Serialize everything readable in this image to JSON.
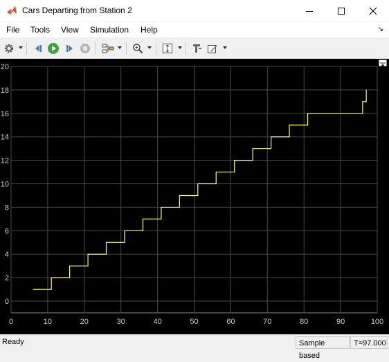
{
  "window": {
    "title": "Cars Departing from Station 2"
  },
  "menu": {
    "items": [
      "File",
      "Tools",
      "View",
      "Simulation",
      "Help"
    ]
  },
  "toolbar": {
    "icons": [
      "settings-icon",
      "step-back-icon",
      "run-icon",
      "step-forward-icon",
      "stop-icon",
      "highlight-icon",
      "zoom-icon",
      "autoscale-icon",
      "cursor-measure-icon",
      "style-icon"
    ]
  },
  "status": {
    "ready": "Ready",
    "mode": "Sample based",
    "time": "T=97.000"
  },
  "colors": {
    "plot_bg": "#000000",
    "grid": "#4a4a4a",
    "axis_text": "#cfcfcf",
    "line": "#ffff66"
  },
  "chart_data": {
    "type": "line",
    "title": "",
    "xlabel": "",
    "ylabel": "",
    "xlim": [
      0,
      100
    ],
    "ylim": [
      -1,
      20
    ],
    "xticks": [
      0,
      10,
      20,
      30,
      40,
      50,
      60,
      70,
      80,
      90,
      100
    ],
    "yticks": [
      0,
      2,
      4,
      6,
      8,
      10,
      12,
      14,
      16,
      18,
      20
    ],
    "grid": true,
    "series": [
      {
        "step": true,
        "x": [
          6,
          11,
          16,
          21,
          26,
          31,
          36,
          41,
          46,
          51,
          56,
          61,
          66,
          71,
          76,
          81,
          96,
          97
        ],
        "y": [
          1,
          2,
          3,
          4,
          5,
          6,
          7,
          8,
          9,
          10,
          11,
          12,
          13,
          14,
          15,
          16,
          17,
          18
        ]
      }
    ]
  }
}
